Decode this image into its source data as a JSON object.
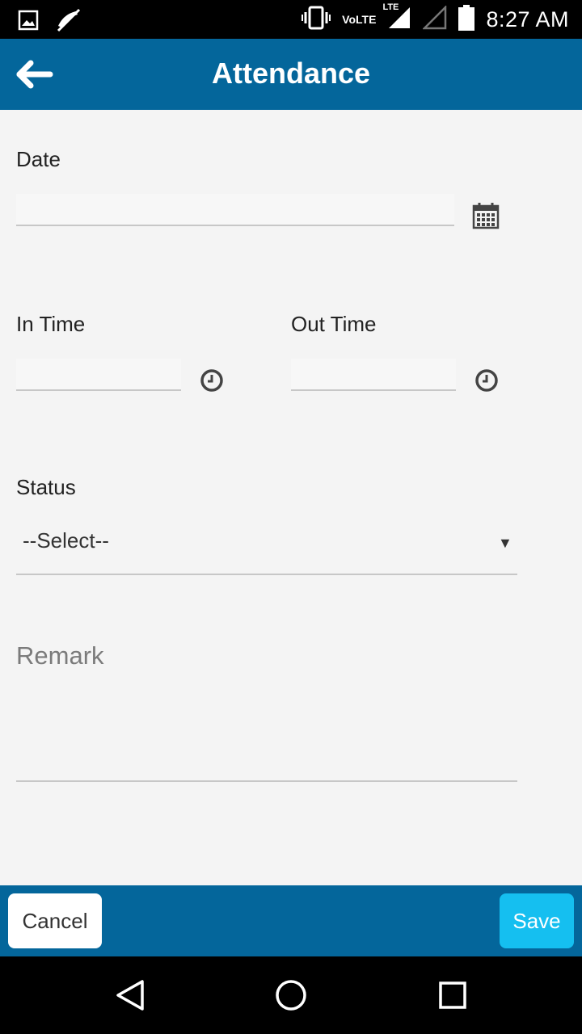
{
  "status_bar": {
    "time": "8:27 AM",
    "volte": "VoLTE",
    "lte": "LTE",
    "icons": [
      "image-icon",
      "mute-icon",
      "vibrate-icon",
      "signal-icon",
      "battery-icon"
    ]
  },
  "app_bar": {
    "title": "Attendance",
    "back_icon": "arrow-left-icon",
    "background": "#04669b"
  },
  "form": {
    "date_label": "Date",
    "date_value": "",
    "in_time_label": "In Time",
    "in_time_value": "",
    "out_time_label": "Out Time",
    "out_time_value": "",
    "status_label": "Status",
    "status_selected": "--Select--",
    "remark_placeholder": "Remark",
    "remark_value": ""
  },
  "actions": {
    "cancel_label": "Cancel",
    "save_label": "Save",
    "save_color": "#15bff0"
  },
  "nav_bar": {
    "icons": [
      "back-triangle-icon",
      "home-circle-icon",
      "recents-square-icon"
    ]
  }
}
